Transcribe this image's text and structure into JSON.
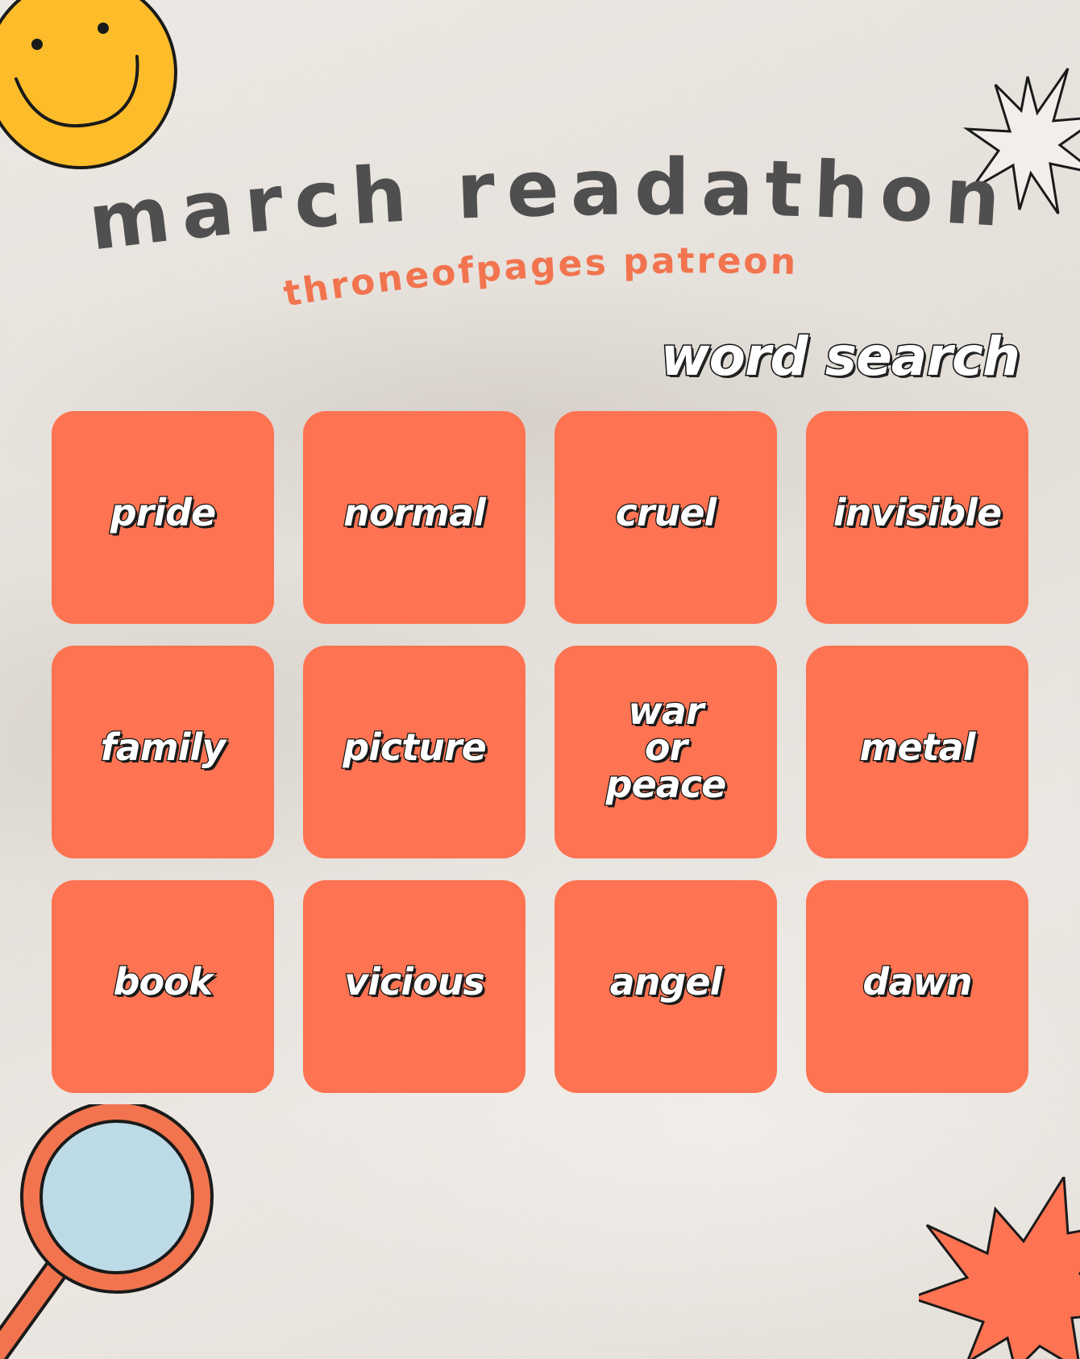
{
  "header": {
    "title": "march readathon",
    "subtitle": "throneofpages patreon"
  },
  "section": {
    "heading": "word search"
  },
  "words": [
    "pride",
    "normal",
    "cruel",
    "invisible",
    "family",
    "picture",
    "war\nor\npeace",
    "metal",
    "book",
    "vicious",
    "angel",
    "dawn"
  ],
  "icons": {
    "top_left": "smiley-face-icon",
    "top_right": "starburst-icon",
    "bottom_left": "magnifying-glass-icon",
    "bottom_right": "starburst-icon"
  },
  "colors": {
    "tile": "#fe7352",
    "title": "#4f4f4f",
    "subtitle": "#f2744f",
    "smiley": "#fdbd2a",
    "lens": "#bcdbe6"
  }
}
